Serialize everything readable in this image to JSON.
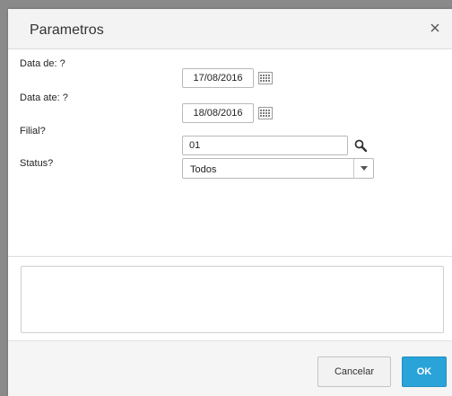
{
  "dialog": {
    "title": "Parametros",
    "close_icon": "close-icon"
  },
  "fields": {
    "data_de": {
      "label": "Data de: ?",
      "value": "17/08/2016",
      "icon": "calendar-icon"
    },
    "data_ate": {
      "label": "Data ate: ?",
      "value": "18/08/2016",
      "icon": "calendar-icon"
    },
    "filial": {
      "label": "Filial?",
      "value": "01",
      "icon": "search-icon"
    },
    "status": {
      "label": "Status?",
      "value": "Todos",
      "icon": "chevron-down-icon"
    }
  },
  "notes": {
    "value": ""
  },
  "footer": {
    "cancel_label": "Cancelar",
    "ok_label": "OK"
  },
  "colors": {
    "ok_button": "#2aa3d9",
    "title_bar": "#f3f3f3",
    "footer": "#f5f5f5"
  }
}
